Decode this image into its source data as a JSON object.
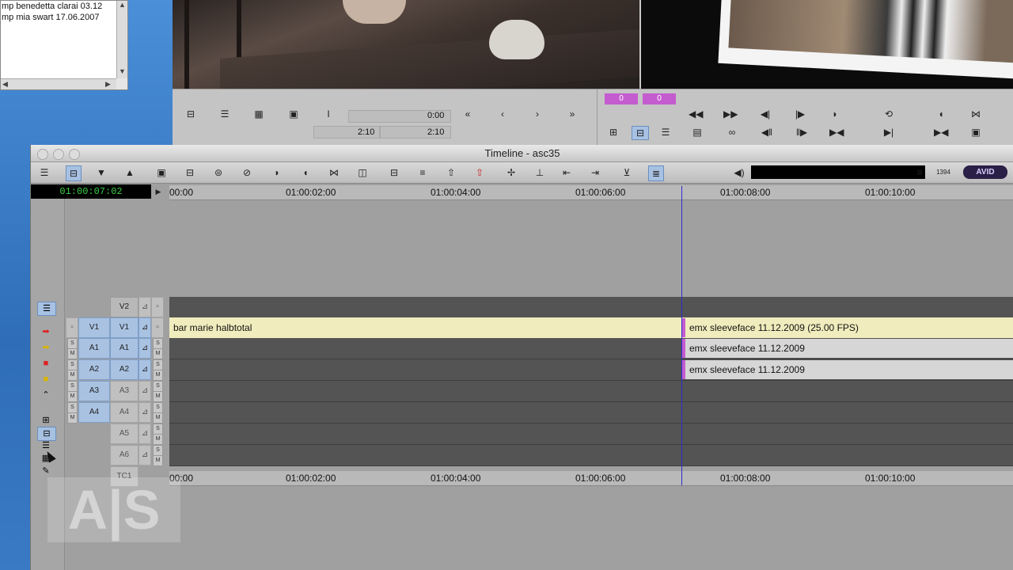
{
  "bin_window": {
    "lines": [
      "mp benedetta clarai 03.12",
      "mp mia swart 17.06.2007"
    ]
  },
  "composer": {
    "badges": [
      "0",
      "0"
    ],
    "source_time": "0:00",
    "source_duration": "2:10",
    "record_duration": "2:10",
    "buttons": {
      "rewind": "«",
      "step_back": "‹",
      "step_fwd": "›",
      "fast_fwd": "»"
    }
  },
  "timeline": {
    "title": "Timeline - asc35",
    "timecode": "01:00:07:02",
    "ruler_top": [
      "00:00",
      "01:00:02:00",
      "01:00:04:00",
      "01:00:06:00",
      "01:00:08:00",
      "01:00:10:00"
    ],
    "ruler_bottom": [
      "00:00",
      "01:00:02:00",
      "01:00:04:00",
      "01:00:06:00",
      "01:00:08:00",
      "01:00:10:00"
    ],
    "avid_label": "AVID",
    "tracks": [
      {
        "id": "V2",
        "src": "",
        "rec": "V2",
        "clips": []
      },
      {
        "id": "V1",
        "src": "V1",
        "rec": "V1",
        "clips": [
          {
            "label": "bar marie halbtotal",
            "kind": "v"
          },
          {
            "label": "emx sleeveface 11.12.2009 (25.00 FPS)",
            "kind": "v"
          }
        ]
      },
      {
        "id": "A1",
        "src": "A1",
        "rec": "A1",
        "clips": [
          {
            "label": "emx sleeveface 11.12.2009",
            "kind": "a"
          }
        ]
      },
      {
        "id": "A2",
        "src": "A2",
        "rec": "A2",
        "clips": [
          {
            "label": "emx sleeveface 11.12.2009",
            "kind": "a"
          }
        ]
      },
      {
        "id": "A3",
        "src": "A3",
        "rec": "A3",
        "clips": []
      },
      {
        "id": "A4",
        "src": "A4",
        "rec": "A4",
        "clips": []
      },
      {
        "id": "A5",
        "src": "",
        "rec": "A5",
        "clips": []
      },
      {
        "id": "A6",
        "src": "",
        "rec": "A6",
        "clips": []
      }
    ],
    "tc_track": "TC1",
    "sm": {
      "s": "S",
      "m": "M"
    }
  },
  "watermark": "A|S",
  "colors": {
    "timecode_green": "#3ccf43",
    "playhead": "#2c2cd4",
    "video_clip": "#f1ecbd",
    "audio_clip": "#d6d6d6",
    "badge": "#c45ccf",
    "active_tool": "#a7c1e2"
  },
  "icons": [
    "menu-icon",
    "red-arrow-icon",
    "yellow-arrow-icon",
    "red-block-icon",
    "yellow-block-icon",
    "speaker-icon",
    "avid-logo"
  ]
}
